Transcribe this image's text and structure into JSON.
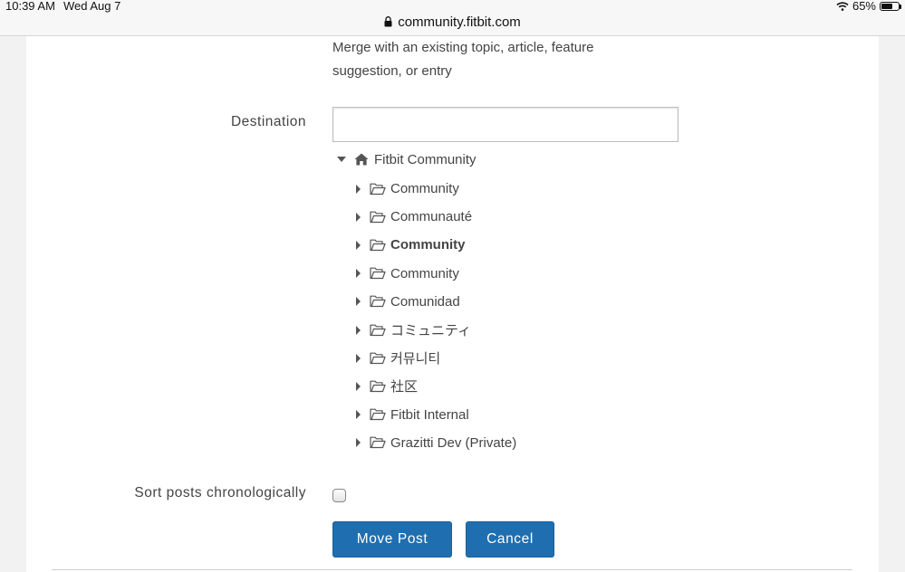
{
  "status_bar": {
    "time": "10:39 AM",
    "date": "Wed Aug 7",
    "url": "community.fitbit.com",
    "battery_text": "65%",
    "battery_level": 0.65
  },
  "form": {
    "merge_description": "Merge with an existing topic, article, feature suggestion, or entry",
    "destination_label": "Destination",
    "destination_value": "",
    "tree": {
      "root_label": "Fitbit Community",
      "items": [
        {
          "label": "Community",
          "bold": false
        },
        {
          "label": "Communauté",
          "bold": false
        },
        {
          "label": "Community",
          "bold": true
        },
        {
          "label": "Community",
          "bold": false
        },
        {
          "label": "Comunidad",
          "bold": false
        },
        {
          "label": "コミュニティ",
          "bold": false
        },
        {
          "label": "커뮤니티",
          "bold": false
        },
        {
          "label": "社区",
          "bold": false
        },
        {
          "label": "Fitbit Internal",
          "bold": false
        },
        {
          "label": "Grazitti Dev (Private)",
          "bold": false
        }
      ]
    },
    "sort_label": "Sort posts chronologically",
    "sort_checked": false,
    "move_button": "Move Post",
    "cancel_button": "Cancel"
  },
  "colors": {
    "button_bg": "#1f6fb0",
    "page_bg": "#ffffff",
    "outer_bg": "#f2f2f2"
  }
}
